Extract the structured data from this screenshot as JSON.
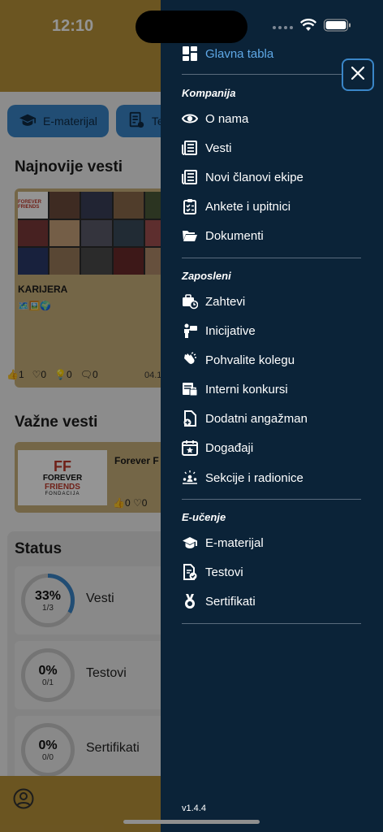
{
  "status_bar": {
    "time": "12:10"
  },
  "background": {
    "chips": [
      {
        "label": "E-materijal",
        "icon": "graduation-cap-icon"
      },
      {
        "label": "Te",
        "icon": "test-icon"
      }
    ],
    "latest_news_title": "Najnovije vesti",
    "news_card": {
      "collage_text": "FOREVER FRIENDS",
      "collage_sub": "FONDACIJA",
      "tag": "KARIJERA",
      "emoji": "🗺️🖼️🌍",
      "likes": "1",
      "hearts": "0",
      "ideas": "0",
      "comments": "0",
      "date": "04.1"
    },
    "important_news_title": "Važne vesti",
    "important_card": {
      "logo_line1": "FOREVER",
      "logo_line2": "FRIENDS",
      "logo_line3": "FONDACIJA",
      "title": "Forever F",
      "likes": "0",
      "hearts": "0"
    },
    "status_title": "Status",
    "status_items": [
      {
        "percent": "33%",
        "fraction": "1/3",
        "label": "Vesti",
        "progress": 0.33
      },
      {
        "percent": "0%",
        "fraction": "0/1",
        "label": "Testovi",
        "progress": 0
      },
      {
        "percent": "0%",
        "fraction": "0/0",
        "label": "Sertifikati",
        "progress": 0
      }
    ]
  },
  "drawer": {
    "top_item": {
      "label": "Glavna tabla",
      "icon": "dashboard-grid-icon"
    },
    "groups": [
      {
        "title": "Kompanija",
        "items": [
          {
            "label": "O nama",
            "icon": "eye-icon"
          },
          {
            "label": "Vesti",
            "icon": "newspaper-icon"
          },
          {
            "label": "Novi članovi ekipe",
            "icon": "newspaper-icon"
          },
          {
            "label": "Ankete i upitnici",
            "icon": "clipboard-check-icon"
          },
          {
            "label": "Dokumenti",
            "icon": "folder-open-icon"
          }
        ]
      },
      {
        "title": "Zaposleni",
        "items": [
          {
            "label": "Zahtevi",
            "icon": "briefcase-clock-icon"
          },
          {
            "label": "Inicijative",
            "icon": "person-sign-icon"
          },
          {
            "label": "Pohvalite kolegu",
            "icon": "clapping-hands-icon"
          },
          {
            "label": "Interni konkursi",
            "icon": "job-board-icon"
          },
          {
            "label": "Dodatni angažman",
            "icon": "document-plus-icon"
          },
          {
            "label": "Događaji",
            "icon": "calendar-star-icon"
          },
          {
            "label": "Sekcije i radionice",
            "icon": "group-spotlight-icon"
          }
        ]
      },
      {
        "title": "E-učenje",
        "items": [
          {
            "label": "E-materijal",
            "icon": "graduation-cap-icon"
          },
          {
            "label": "Testovi",
            "icon": "test-sheet-icon"
          },
          {
            "label": "Sertifikati",
            "icon": "medal-icon"
          }
        ]
      }
    ],
    "version": "v1.4.4"
  },
  "colors": {
    "drawer_bg": "#0b2338",
    "accent_blue": "#3a86c8",
    "header_gold": "#b8933a"
  }
}
